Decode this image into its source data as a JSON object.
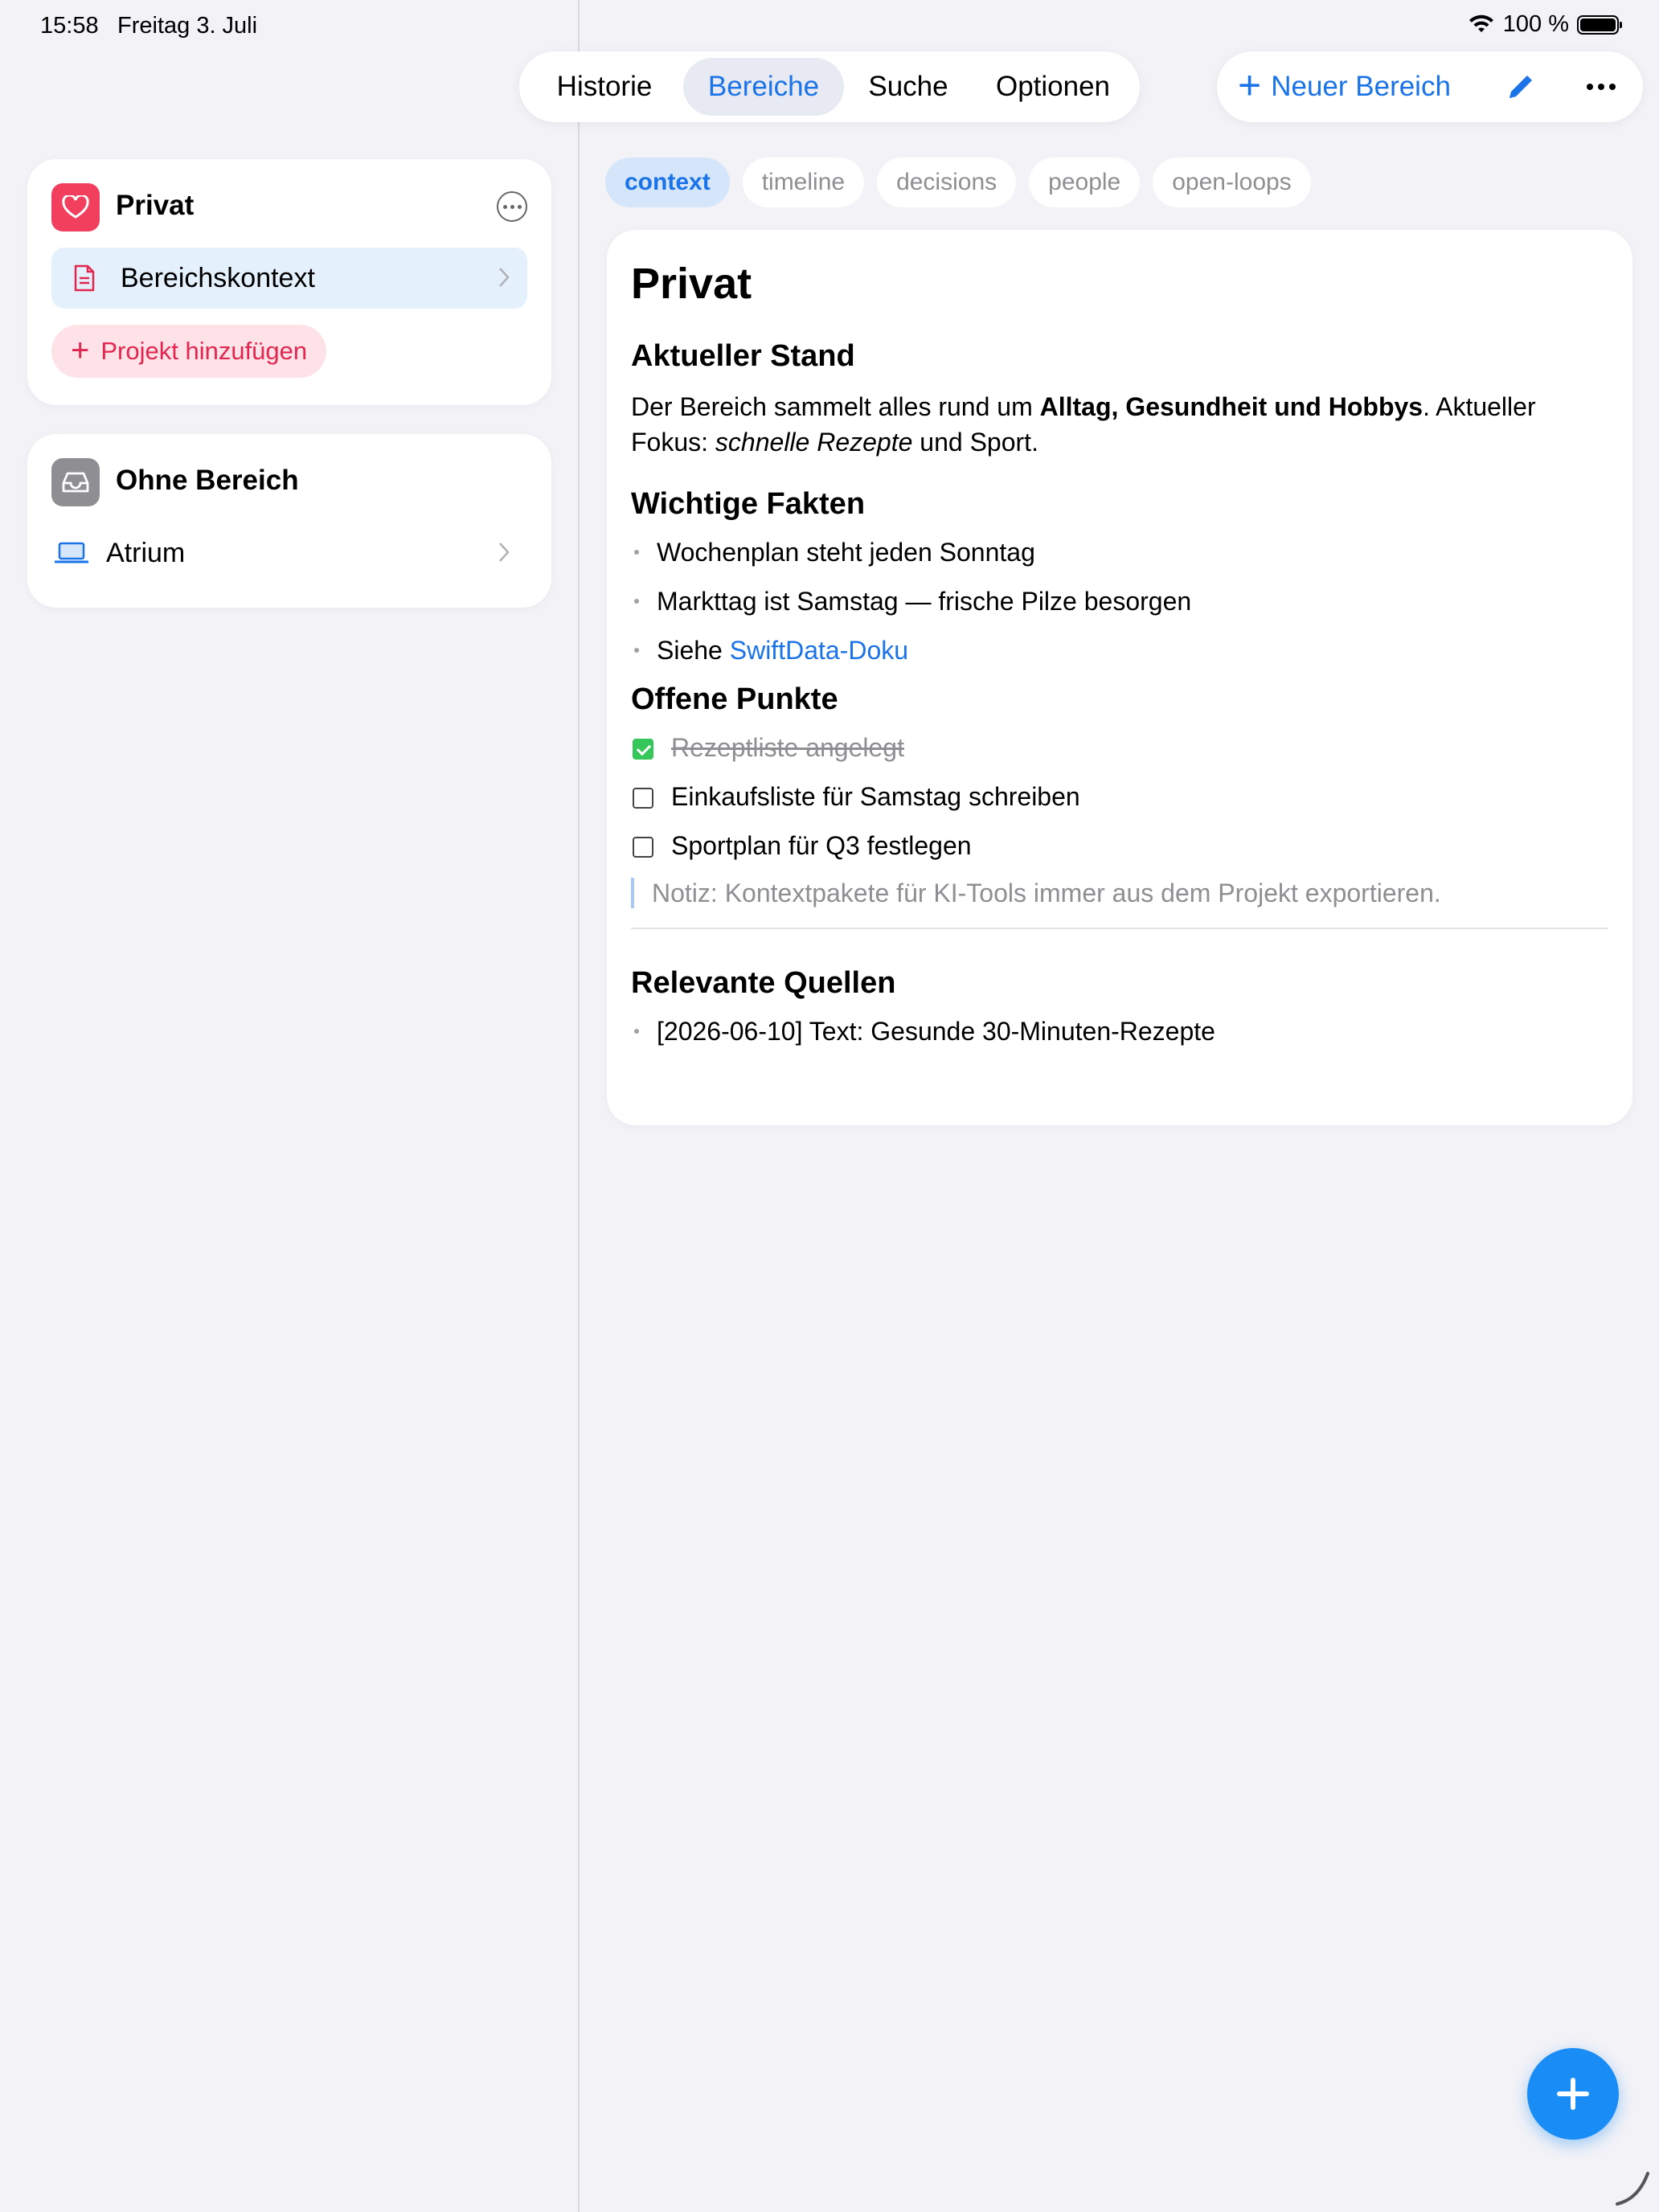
{
  "status_bar": {
    "time": "15:58",
    "date": "Freitag 3. Juli",
    "battery": "100 %"
  },
  "nav": {
    "tabs": [
      {
        "label": "Historie"
      },
      {
        "label": "Bereiche",
        "active": true
      },
      {
        "label": "Suche"
      },
      {
        "label": "Optionen"
      }
    ]
  },
  "toolbar": {
    "new_area_label": "Neuer Bereich",
    "accent": "#1a73e8"
  },
  "sidebar": {
    "areas": [
      {
        "name": "Privat",
        "icon": "heart-icon",
        "icon_color": "#f23f5e",
        "items": [
          {
            "label": "Bereichskontext",
            "icon": "document-icon",
            "selected": true
          }
        ],
        "add_project_label": "Projekt hinzufügen"
      },
      {
        "name": "Ohne Bereich",
        "icon": "tray-icon",
        "icon_color": "#8e8e93",
        "items": [
          {
            "label": "Atrium",
            "icon": "laptop-icon"
          }
        ]
      }
    ]
  },
  "file_tabs": [
    {
      "label": "context",
      "active": true
    },
    {
      "label": "timeline"
    },
    {
      "label": "decisions"
    },
    {
      "label": "people"
    },
    {
      "label": "open-loops"
    }
  ],
  "document": {
    "title": "Privat",
    "current_state": {
      "heading": "Aktueller Stand",
      "text_1": "Der Bereich sammelt alles rund um ",
      "bold": "Alltag, Gesundheit und Hobbys",
      "text_2": ". Aktueller Fokus: ",
      "italic": "schnelle Rezepte",
      "text_3": " und Sport."
    },
    "facts": {
      "heading": "Wichtige Fakten",
      "items": [
        "Wochenplan steht jeden Sonntag",
        "Markttag ist Samstag — frische Pilze besorgen"
      ],
      "link_prefix": "Siehe ",
      "link_text": "SwiftData-Doku"
    },
    "open_points": {
      "heading": "Offene Punkte",
      "items": [
        {
          "label": "Rezeptliste angelegt",
          "checked": true
        },
        {
          "label": "Einkaufsliste für Samstag schreiben",
          "checked": false
        },
        {
          "label": "Sportplan für Q3 festlegen",
          "checked": false
        }
      ],
      "note": "Notiz: Kontextpakete für KI-Tools immer aus dem Projekt exportieren."
    },
    "sources": {
      "heading": "Relevante Quellen",
      "items": [
        "[2026-06-10] Text: Gesunde 30-Minuten-Rezepte"
      ]
    }
  }
}
